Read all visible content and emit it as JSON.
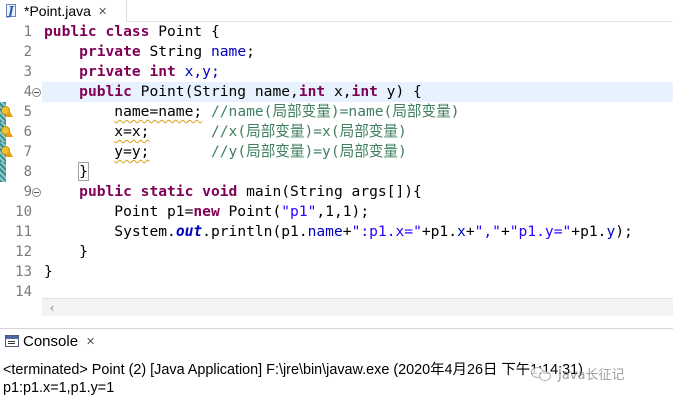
{
  "editor_tab": {
    "title": "*Point.java",
    "close_icon": "close-icon"
  },
  "line_numbers": [
    "1",
    "2",
    "3",
    "4",
    "5",
    "6",
    "7",
    "8",
    "9",
    "10",
    "11",
    "12",
    "13",
    "14"
  ],
  "code": {
    "l1": {
      "kw": "public class",
      "rest": " Point {"
    },
    "l2": {
      "kw": "private",
      "rest": " String ",
      "fld": "name",
      "end": ";"
    },
    "l3": {
      "kw1": "private",
      "kw2": "int",
      "rest": " x,y;"
    },
    "l4": {
      "kw": "public",
      "a": " Point(String name,",
      "kw2": "int",
      "b": " x,",
      "kw3": "int",
      "c": " y) {"
    },
    "l5": {
      "code": "name=name;",
      "comment": " //name(局部变量)=name(局部变量)"
    },
    "l6": {
      "code": "x=x;",
      "comment": "       //x(局部变量)=x(局部变量)"
    },
    "l7": {
      "code": "y=y;",
      "comment": "       //y(局部变量)=y(局部变量)"
    },
    "l8": {
      "brace": "}"
    },
    "l9": {
      "kw": "public static void",
      "rest": " main(String args[]){"
    },
    "l10": {
      "a": "Point p1=",
      "kw": "new",
      "b": " Point(",
      "str": "\"p1\"",
      "c": ",1,1);"
    },
    "l11": {
      "a": "System.",
      "st": "out",
      "b": ".println(p1.",
      "fld1": "name",
      "c": "+",
      "str1": "\":p1.x=\"",
      "d": "+p1.",
      "fld2": "x",
      "e": "+",
      "str2": "\",\"",
      "f": "+",
      "str3": "\"p1.y=\"",
      "g": "+p1.",
      "fld3": "y",
      "h": ");"
    },
    "l12": {
      "text": "}"
    },
    "l13": {
      "text": "}"
    }
  },
  "console": {
    "tab_title": "Console",
    "terminated_line": "<terminated> Point (2) [Java Application] F:\\jre\\bin\\javaw.exe (2020年4月26日 下午1:14:31)",
    "output": "p1:p1.x=1,p1.y=1"
  },
  "watermark": {
    "text": "Java长征记"
  },
  "colors": {
    "keyword": "#7f0055",
    "field": "#0000c0",
    "comment": "#3f7f5f",
    "string": "#2a00ff",
    "current_line": "#e8f2fe"
  }
}
